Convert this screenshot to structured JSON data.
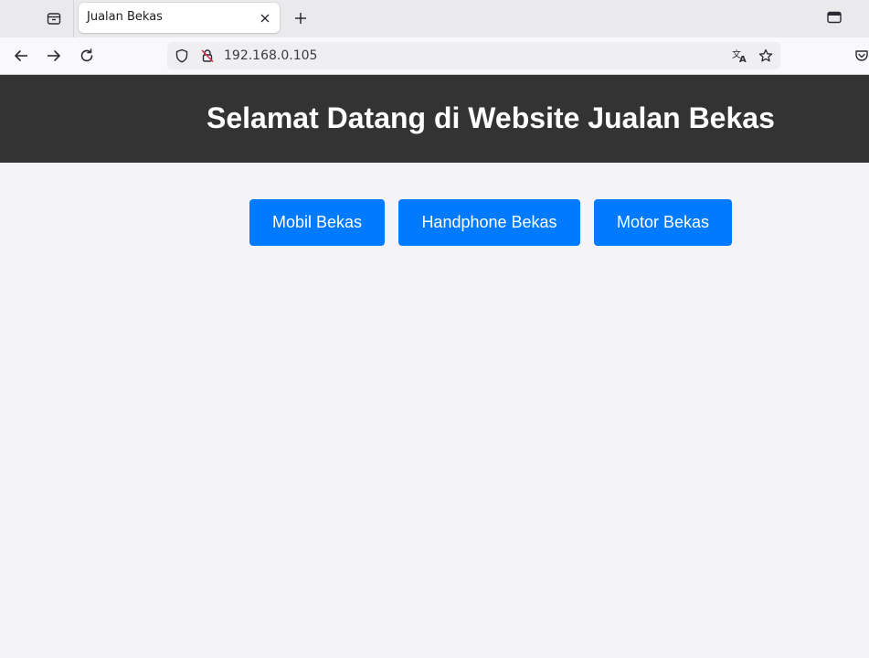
{
  "browser": {
    "tab_title": "Jualan Bekas",
    "url": "192.168.0.105",
    "icons": {
      "tab_list": "tab-list-icon",
      "close": "close-icon",
      "new_tab": "plus-icon",
      "window": "window-icon",
      "back": "arrow-left-icon",
      "forward": "arrow-right-icon",
      "reload": "reload-icon",
      "tracking": "shield-icon",
      "insecure": "insecure-lock-icon",
      "translate": "translate-icon",
      "bookmark": "star-icon",
      "pocket": "pocket-icon"
    }
  },
  "page": {
    "header_title": "Selamat Datang di Website Jualan Bekas",
    "buttons": [
      {
        "label": "Mobil Bekas"
      },
      {
        "label": "Handphone Bekas"
      },
      {
        "label": "Motor Bekas"
      }
    ]
  },
  "colors": {
    "header_bg": "#333333",
    "button_bg": "#007bff",
    "page_bg": "#f4f4f8"
  }
}
